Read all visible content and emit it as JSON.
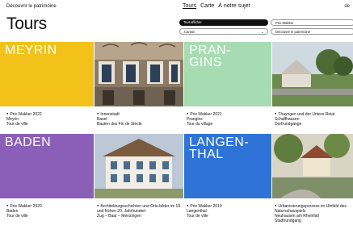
{
  "header": {
    "site_title": "Découvrir le patrimoine",
    "nav": [
      "Tours",
      "Carte",
      "À notre sujet"
    ],
    "lang": "de"
  },
  "page_title": "Tours",
  "filters": {
    "show_all": "Tout afficher",
    "prize": "Prix Wakker",
    "canton": "Canton",
    "discover": "Découvrir le patrimoine"
  },
  "tiles": [
    {
      "word": "MEYRIN",
      "color": "#f2c21a",
      "prize": "Prix Wakker 2022",
      "line2": "Meyrin",
      "line3": "Tour de ville"
    },
    {
      "word": "",
      "color": "#8a7a66",
      "prize": "Innenstadt",
      "line2": "Basel",
      "line3": "Bauten des Fin de Siècle"
    },
    {
      "word": "PRAN-\nGINS",
      "color": "#a7dcb2",
      "prize": "Prix Wakker 2021",
      "line2": "Prangins",
      "line3": "Tour du village"
    },
    {
      "word": "",
      "color": "#7f9c6b",
      "prize": "Thayngen und der Untere Reiat",
      "line2": "Schaffhausen",
      "line3": "Dorfrundgänge"
    },
    {
      "word": "BADEN",
      "color": "#8b5fb7",
      "prize": "Prix Wakker 2020",
      "line2": "Baden",
      "line3": "Tour de ville"
    },
    {
      "word": "",
      "color": "#a9b7c8",
      "prize": "Architekturgeschichten und Orts-bilder im 19. und frühen 20. Jahrhundert",
      "line2": "Zug – Baar – Menzingen",
      "line3": ""
    },
    {
      "word": "LANGEN-\nTHAL",
      "color": "#2f73d6",
      "prize": "Prix Wakker 2019",
      "line2": "Langenthal",
      "line3": "Tour de ville"
    },
    {
      "word": "",
      "color": "#7a8a63",
      "prize": "Urbanisierungsprozess im Umfeld des Naturschauspiels",
      "line2": "Neuhausen am Rheinfall",
      "line3": "Stadtrundgang"
    }
  ]
}
